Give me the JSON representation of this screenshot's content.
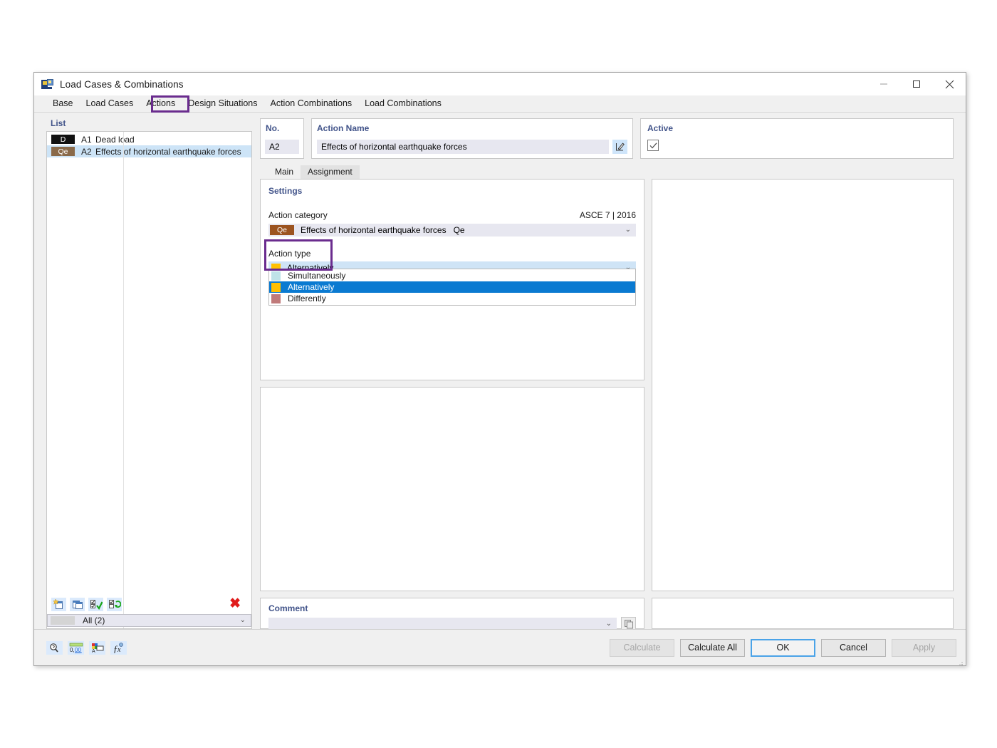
{
  "window": {
    "title": "Load Cases & Combinations",
    "icon": "load-cases-icon",
    "minimize": "–",
    "maximize": "□",
    "close": "✕"
  },
  "tabs": [
    {
      "label": "Base",
      "active": false
    },
    {
      "label": "Load Cases",
      "active": false
    },
    {
      "label": "Actions",
      "active": true
    },
    {
      "label": "Design Situations",
      "active": false
    },
    {
      "label": "Action Combinations",
      "active": false
    },
    {
      "label": "Load Combinations",
      "active": false
    }
  ],
  "list": {
    "header": "List",
    "rows": [
      {
        "badge": "D",
        "no": "A1",
        "name": "Dead load",
        "selected": false
      },
      {
        "badge": "Qe",
        "no": "A2",
        "name": "Effects of horizontal earthquake forces",
        "selected": true
      }
    ],
    "toolbar": {
      "new": "new-item-icon",
      "copy": "copy-item-icon",
      "check_all": "check-all-icon",
      "toggle_check": "toggle-check-icon",
      "delete": "✖"
    },
    "filter": {
      "label": "All (2)",
      "arrow": "⌄"
    }
  },
  "header": {
    "no_label": "No.",
    "no_value": "A2",
    "name_label": "Action Name",
    "name_value": "Effects of horizontal earthquake forces",
    "edit_icon": "edit-pencil-icon",
    "active_label": "Active",
    "active_checked": true
  },
  "inner_tabs": [
    {
      "label": "Main",
      "active": true
    },
    {
      "label": "Assignment",
      "active": false
    }
  ],
  "settings": {
    "title": "Settings",
    "action_category_label": "Action category",
    "standard": "ASCE 7 | 2016",
    "category": {
      "badge": "Qe",
      "badge_color": "#9c5420",
      "text": "Effects of horizontal earthquake forces",
      "abbr": "Qe",
      "arrow": "⌄"
    },
    "action_type_label": "Action type",
    "action_type_value": "Alternatively",
    "action_type_color": "#ffc000",
    "action_type_arrow": "⌄",
    "dropdown_options": [
      {
        "label": "Simultaneously",
        "color": "#bfe3e8",
        "selected": false
      },
      {
        "label": "Alternatively",
        "color": "#ffc000",
        "selected": true
      },
      {
        "label": "Differently",
        "color": "#c07a7a",
        "selected": false
      }
    ]
  },
  "comment": {
    "title": "Comment",
    "value": "",
    "arrow": "⌄",
    "copy_icon": "copy-comment-icon"
  },
  "footer": {
    "icons": [
      {
        "name": "zoom-help-icon"
      },
      {
        "name": "decimal-places-icon",
        "label": "0,00"
      },
      {
        "name": "color-label-icon"
      },
      {
        "name": "function-fx-icon"
      }
    ],
    "buttons": [
      {
        "label": "Calculate",
        "state": "disabled"
      },
      {
        "label": "Calculate All",
        "state": "normal"
      },
      {
        "label": "OK",
        "state": "focus"
      },
      {
        "label": "Cancel",
        "state": "normal"
      },
      {
        "label": "Apply",
        "state": "disabled"
      }
    ]
  },
  "highlights": {
    "accent_color": "#6a2c8e",
    "boxes": [
      "actions-tab",
      "action-type-field"
    ]
  }
}
